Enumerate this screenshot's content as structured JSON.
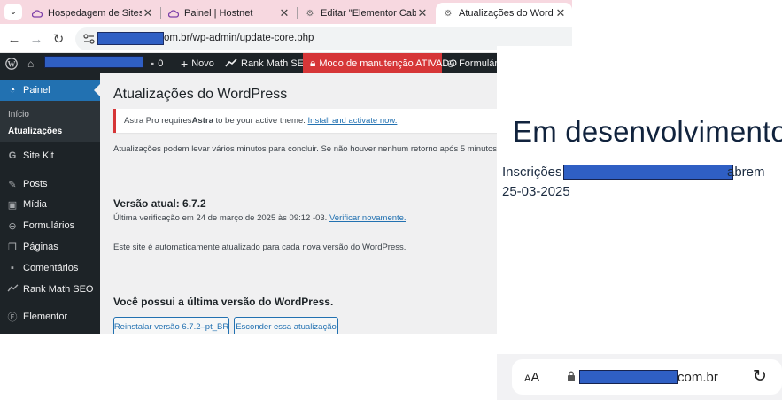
{
  "browser": {
    "tabs": [
      {
        "title": "Hospedagem de Sites Word",
        "icon": "cloud-icon",
        "active": false
      },
      {
        "title": "Painel | Hostnet",
        "icon": "cloud-icon",
        "active": false
      },
      {
        "title": "Editar \"Elementor Cabeçalho\"",
        "icon": "gear-icon",
        "active": false
      },
      {
        "title": "Atualizações do WordPress ‹",
        "icon": "gear-icon",
        "active": true
      }
    ],
    "url_suffix": "om.br/wp-admin/update-core.php"
  },
  "adminbar": {
    "comments_count": "0",
    "new_label": "Novo",
    "rankmath_label": "Rank Math SEO",
    "maintenance_label": "Modo de manutenção ATIVADO",
    "forms_label": "Formulário"
  },
  "sidebar": {
    "painel_label": "Painel",
    "sub_items": [
      "Início",
      "Atualizações"
    ],
    "items": [
      {
        "label": "Site Kit",
        "icon": "g-icon"
      },
      {
        "label": "Posts",
        "icon": "pin-icon"
      },
      {
        "label": "Mídia",
        "icon": "media-icon"
      },
      {
        "label": "Formulários",
        "icon": "forms-icon"
      },
      {
        "label": "Páginas",
        "icon": "pages-icon"
      },
      {
        "label": "Comentários",
        "icon": "comment-icon"
      },
      {
        "label": "Rank Math SEO",
        "icon": "chart-icon"
      },
      {
        "label": "Elementor",
        "icon": "elementor-icon"
      }
    ]
  },
  "content": {
    "title": "Atualizações do WordPress",
    "notice_prefix": "Astra Pro requires ",
    "notice_bold": "Astra",
    "notice_middle": " to be your active theme. ",
    "notice_link": "Install and activate now.",
    "info_text": "Atualizações podem levar vários minutos para concluir. Se não houver nenhum retorno após 5 minutos, ou s",
    "version_heading": "Versão atual: 6.7.2",
    "last_check": "Última verificação em 24 de março de 2025 às 09:12 -03.",
    "check_again": "Verificar novamente.",
    "auto_text": "Este site é automaticamente atualizado para cada nova versão do WordPress.",
    "latest_heading": "Você possui a última versão do WordPress.",
    "reinstall_button": "Reinstalar versão 6.7.2–pt_BR",
    "hide_button": "Esconder essa atualização"
  },
  "mobile": {
    "title": "Em desenvolvimento",
    "line1_prefix": "Inscrições",
    "line1_suffix": "abrem",
    "line2": "25-03-2025",
    "aa_small": "A",
    "aa_big": "A",
    "url_suffix": "com.br"
  }
}
